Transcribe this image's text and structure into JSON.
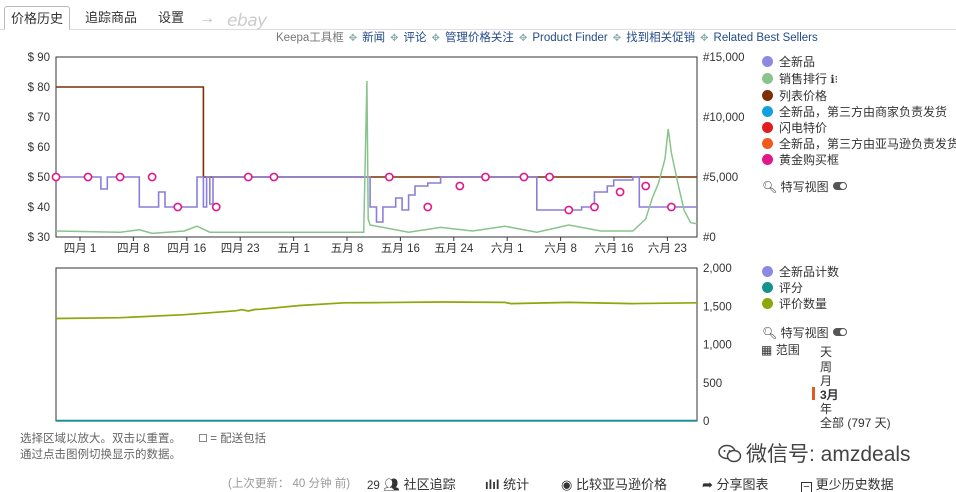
{
  "tabs": [
    {
      "label": "价格历史",
      "active": true
    },
    {
      "label": "追踪商品",
      "active": false
    },
    {
      "label": "设置",
      "active": false
    }
  ],
  "arrow_glyph": "→",
  "ebay_label": "ebay",
  "toolbar": {
    "keepa_box": "Keepa工具框",
    "links": [
      "新闻",
      "评论",
      "管理价格关注",
      "Product Finder",
      "找到相关促销",
      "Related Best Sellers"
    ]
  },
  "top_chart": {
    "y_left_ticks": [
      "$ 90",
      "$ 80",
      "$ 70",
      "$ 60",
      "$ 50",
      "$ 40",
      "$ 30"
    ],
    "y_right_ticks": [
      "#15,000",
      "#10,000",
      "#5,000",
      "#0"
    ],
    "x_ticks": [
      "四月 1",
      "四月 8",
      "四月 16",
      "四月 23",
      "五月 1",
      "五月 8",
      "五月 16",
      "五月 24",
      "六月 1",
      "六月 8",
      "六月 16",
      "六月 23"
    ]
  },
  "bottom_chart": {
    "y_right_ticks": [
      "2,000",
      "1,500",
      "1,000",
      "500",
      "0"
    ]
  },
  "chart_data": [
    {
      "type": "line",
      "y_left_range": [
        30,
        90
      ],
      "y_right_range": [
        0,
        15000
      ],
      "x_labels": [
        "四月 1",
        "四月 8",
        "四月 16",
        "四月 23",
        "五月 1",
        "五月 8",
        "五月 16",
        "五月 24",
        "六月 1",
        "六月 8",
        "六月 16",
        "六月 23"
      ],
      "series": [
        {
          "name": "列表价格",
          "color": "#7a3000",
          "axis": "left",
          "points": [
            [
              0,
              80
            ],
            [
              23,
              80
            ],
            [
              23,
              50
            ],
            [
              100,
              50
            ]
          ]
        },
        {
          "name": "全新品",
          "color": "#8a7fd8",
          "axis": "left",
          "points": [
            [
              0,
              50
            ],
            [
              7,
              50
            ],
            [
              7,
              46
            ],
            [
              8,
              46
            ],
            [
              8,
              50
            ],
            [
              13,
              50
            ],
            [
              13,
              40
            ],
            [
              16,
              40
            ],
            [
              16,
              45
            ],
            [
              17,
              45
            ],
            [
              17,
              40
            ],
            [
              22,
              40
            ],
            [
              22,
              50
            ],
            [
              23,
              50
            ],
            [
              23,
              40
            ],
            [
              23.5,
              40
            ],
            [
              23.5,
              50
            ],
            [
              24,
              50
            ],
            [
              24,
              41
            ],
            [
              24.5,
              41
            ],
            [
              24.5,
              50
            ],
            [
              49,
              50
            ],
            [
              49,
              40
            ],
            [
              50,
              40
            ],
            [
              50,
              35
            ],
            [
              51,
              35
            ],
            [
              51,
              40
            ],
            [
              53,
              40
            ],
            [
              53,
              43
            ],
            [
              54,
              43
            ],
            [
              54,
              39
            ],
            [
              55,
              39
            ],
            [
              55,
              44
            ],
            [
              56,
              44
            ],
            [
              56,
              47
            ],
            [
              58,
              47
            ],
            [
              58,
              48
            ],
            [
              60,
              48
            ],
            [
              60,
              50
            ],
            [
              75,
              50
            ],
            [
              75,
              39
            ],
            [
              82,
              39
            ],
            [
              82,
              40
            ],
            [
              84,
              40
            ],
            [
              84,
              45
            ],
            [
              86,
              45
            ],
            [
              86,
              47
            ],
            [
              87,
              47
            ],
            [
              87,
              49
            ],
            [
              90,
              49
            ],
            [
              90,
              50
            ],
            [
              91,
              50
            ],
            [
              91,
              40
            ],
            [
              100,
              40
            ]
          ]
        },
        {
          "name": "销售排行",
          "color": "#88c48c",
          "axis": "right",
          "points": [
            [
              0,
              500
            ],
            [
              10,
              400
            ],
            [
              13,
              600
            ],
            [
              15,
              300
            ],
            [
              20,
              500
            ],
            [
              22,
              900
            ],
            [
              24,
              400
            ],
            [
              48,
              400
            ],
            [
              48.5,
              13000
            ],
            [
              48.7,
              1500
            ],
            [
              49,
              1000
            ],
            [
              55,
              400
            ],
            [
              60,
              800
            ],
            [
              65,
              500
            ],
            [
              70,
              900
            ],
            [
              75,
              400
            ],
            [
              80,
              1000
            ],
            [
              85,
              500
            ],
            [
              90,
              500
            ],
            [
              92,
              1500
            ],
            [
              93,
              3200
            ],
            [
              94,
              4500
            ],
            [
              95,
              6500
            ],
            [
              95.5,
              9000
            ],
            [
              96,
              7000
            ],
            [
              97,
              4500
            ],
            [
              98,
              2200
            ],
            [
              99,
              1200
            ],
            [
              100,
              1100
            ]
          ]
        },
        {
          "name": "黄金购买框",
          "color": "#e0188c",
          "axis": "left",
          "marker": "diamond",
          "points": [
            [
              0,
              50
            ],
            [
              5,
              50
            ],
            [
              10,
              50
            ],
            [
              15,
              50
            ],
            [
              19,
              40
            ],
            [
              25,
              40
            ],
            [
              30,
              50
            ],
            [
              34,
              50
            ],
            [
              52,
              50
            ],
            [
              58,
              40
            ],
            [
              63,
              47
            ],
            [
              67,
              50
            ],
            [
              73,
              50
            ],
            [
              77,
              50
            ],
            [
              80,
              39
            ],
            [
              84,
              40
            ],
            [
              88,
              45
            ],
            [
              92,
              47
            ],
            [
              96,
              40
            ]
          ]
        }
      ]
    },
    {
      "type": "line",
      "y_right_range": [
        0,
        2000
      ],
      "series": [
        {
          "name": "评价数量",
          "color": "#8aa80a",
          "axis": "right",
          "points": [
            [
              0,
              1340
            ],
            [
              10,
              1350
            ],
            [
              20,
              1390
            ],
            [
              28,
              1440
            ],
            [
              29,
              1455
            ],
            [
              30,
              1438
            ],
            [
              31,
              1458
            ],
            [
              32,
              1462
            ],
            [
              38,
              1510
            ],
            [
              45,
              1545
            ],
            [
              50,
              1548
            ],
            [
              60,
              1555
            ],
            [
              70,
              1550
            ],
            [
              71,
              1535
            ],
            [
              80,
              1550
            ],
            [
              90,
              1535
            ],
            [
              100,
              1545
            ]
          ]
        },
        {
          "name": "全新品计数",
          "color": "#8a7fd8",
          "axis": "right",
          "points": [
            [
              0,
              1
            ],
            [
              100,
              1
            ]
          ]
        },
        {
          "name": "评分",
          "color": "#14928c",
          "axis": "right",
          "points": [
            [
              0,
              5
            ],
            [
              100,
              5
            ]
          ]
        }
      ]
    }
  ],
  "legend_top": [
    {
      "label": "全新品",
      "color": "#8a8ae0"
    },
    {
      "label": "销售排行",
      "color": "#88c48c",
      "info": true
    },
    {
      "label": "列表价格",
      "color": "#7a3000"
    },
    {
      "label": "全新品，第三方由商家负责发货",
      "color": "#12a0e0"
    },
    {
      "label": "闪电特价",
      "color": "#e01c1c"
    },
    {
      "label": "全新品，第三方由亚马逊负责发货",
      "color": "#f05a20"
    },
    {
      "label": "黄金购买框",
      "color": "#e0188c"
    }
  ],
  "legend_top_view": "特写视图",
  "legend_bottom": [
    {
      "label": "全新品计数",
      "color": "#8a8ae0"
    },
    {
      "label": "评分",
      "color": "#14928c"
    },
    {
      "label": "评价数量",
      "color": "#8aa80a"
    }
  ],
  "legend_bottom_view": "特写视图",
  "range": {
    "label": "范围",
    "options": [
      {
        "label": "天",
        "active": false
      },
      {
        "label": "周",
        "active": false
      },
      {
        "label": "月",
        "active": false
      },
      {
        "label": "3月",
        "active": true
      },
      {
        "label": "年",
        "active": false
      },
      {
        "label": "全部 (797 天)",
        "active": false
      }
    ]
  },
  "hints": {
    "line1": "选择区域以放大。双击以重置。",
    "shipping": "= 配送包括",
    "line2": "通过点击图例切换显示的数据。"
  },
  "footer": {
    "updated": "(上次更新： 40 分钟 前)",
    "count": "29",
    "community": "社区追踪",
    "stats": "统计",
    "compare": "比较亚马逊价格",
    "share": "分享图表",
    "less_history": "更少历史数据"
  },
  "watermark": {
    "text": "微信号: amzdeals"
  }
}
